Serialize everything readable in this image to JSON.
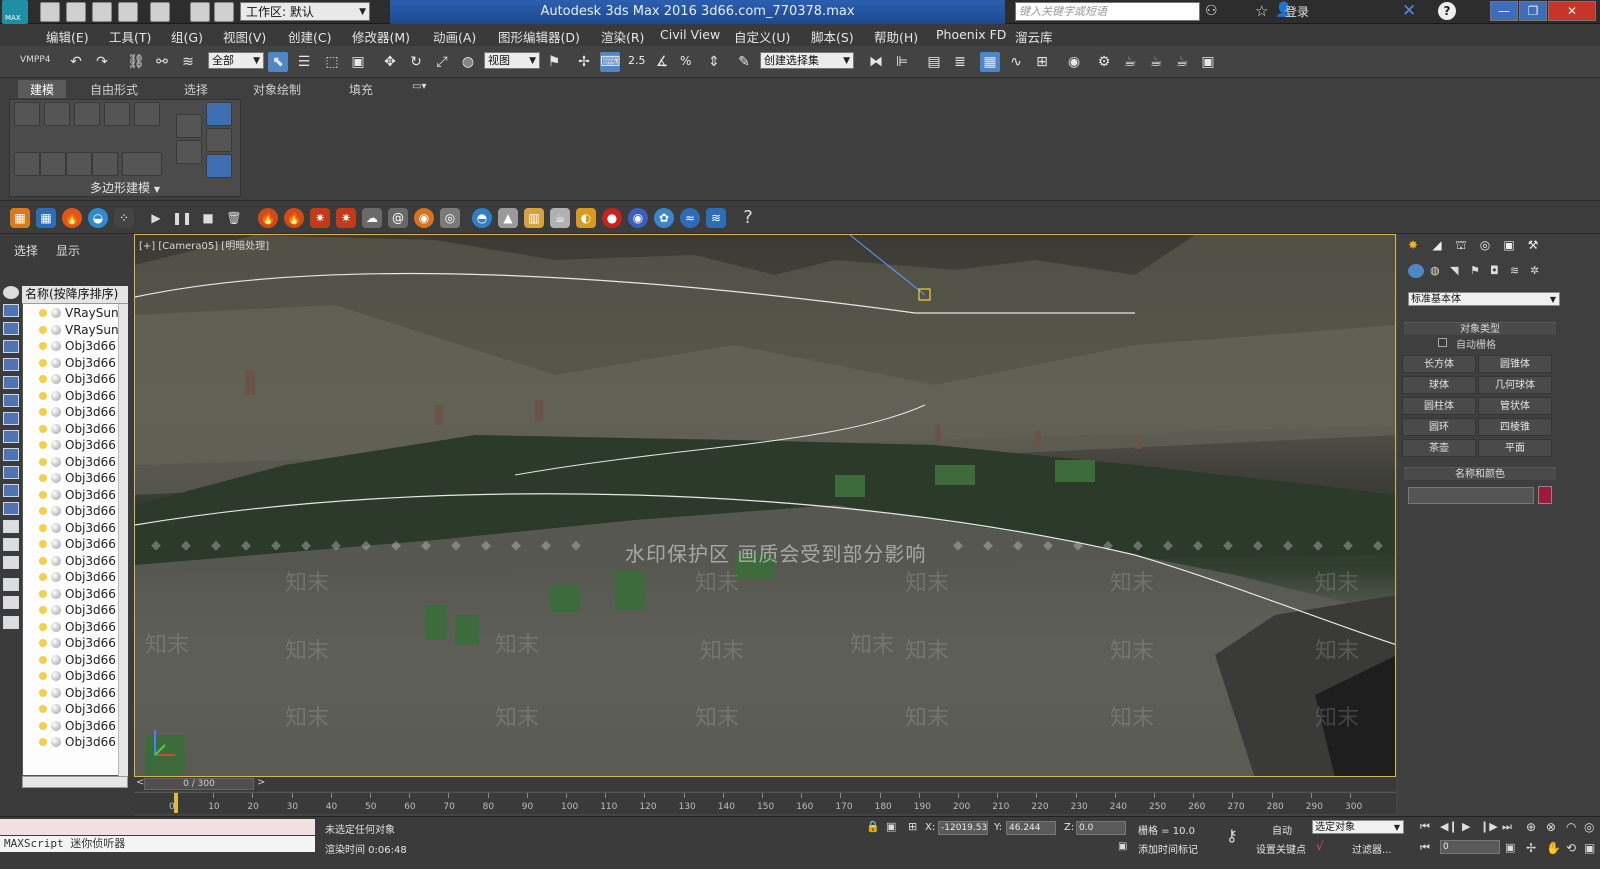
{
  "window": {
    "title": "Autodesk 3ds Max 2016    3d66.com_770378.max",
    "workspace": "工作区: 默认",
    "search_placeholder": "键入关键字或短语",
    "login": "登录",
    "logo": "MAX"
  },
  "menu": [
    "编辑(E)",
    "工具(T)",
    "组(G)",
    "视图(V)",
    "创建(C)",
    "修改器(M)",
    "动画(A)",
    "图形编辑器(D)",
    "渲染(R)",
    "Civil View",
    "自定义(U)",
    "脚本(S)",
    "帮助(H)",
    "Phoenix FD",
    "溜云库"
  ],
  "toolbar": {
    "vmpp": "VMPP4",
    "selection_filter": "全部",
    "ref_coord": "视图",
    "named_selection": "创建选择集",
    "snap": "2.5",
    "angle_snap": "%"
  },
  "ribbon": {
    "tabs": [
      "建模",
      "自由形式",
      "选择",
      "对象绘制",
      "填充"
    ],
    "panel_label": "多边形建模"
  },
  "explorer": {
    "tabs": [
      "选择",
      "显示"
    ],
    "column_header": "名称(按降序排序)",
    "rows": [
      "VRaySun",
      "VRaySun",
      "Obj3d66",
      "Obj3d66",
      "Obj3d66",
      "Obj3d66",
      "Obj3d66",
      "Obj3d66",
      "Obj3d66",
      "Obj3d66",
      "Obj3d66",
      "Obj3d66",
      "Obj3d66",
      "Obj3d66",
      "Obj3d66",
      "Obj3d66",
      "Obj3d66",
      "Obj3d66",
      "Obj3d66",
      "Obj3d66",
      "Obj3d66",
      "Obj3d66",
      "Obj3d66",
      "Obj3d66",
      "Obj3d66",
      "Obj3d66",
      "Obj3d66"
    ]
  },
  "viewport": {
    "label": "[+] [Camera05] [明暗处理]",
    "watermark_main": "水印保护区  画质会受到部分影响",
    "watermark": "知末"
  },
  "command_panel": {
    "dropdown": "标准基本体",
    "object_type_title": "对象类型",
    "autogrid": "自动栅格",
    "buttons": [
      "长方体",
      "圆锥体",
      "球体",
      "几何球体",
      "圆柱体",
      "管状体",
      "圆环",
      "四棱锥",
      "茶壶",
      "平面"
    ],
    "name_color_title": "名称和颜色",
    "color": "#a3173f"
  },
  "timeline": {
    "frame_display": "0 / 300",
    "ticks": [
      "0",
      "10",
      "20",
      "30",
      "40",
      "50",
      "60",
      "70",
      "80",
      "90",
      "100",
      "110",
      "120",
      "130",
      "140",
      "150",
      "160",
      "170",
      "180",
      "190",
      "200",
      "210",
      "220",
      "230",
      "240",
      "250",
      "260",
      "270",
      "280",
      "290",
      "300"
    ]
  },
  "status": {
    "maxscript": "MAXScript 迷你侦听器",
    "selection_status": "未选定任何对象",
    "render_time": "渲染时间 0:06:48",
    "x_label": "X:",
    "x_value": "-12019.53",
    "y_label": "Y:",
    "y_value": "46.244",
    "z_label": "Z:",
    "z_value": "0.0",
    "grid": "栅格 = 10.0",
    "add_time_tag": "添加时间标记",
    "auto": "自动",
    "selected_object": "选定对象",
    "set_key": "设置关键点",
    "filter": "过滤器...",
    "frame": "0"
  }
}
